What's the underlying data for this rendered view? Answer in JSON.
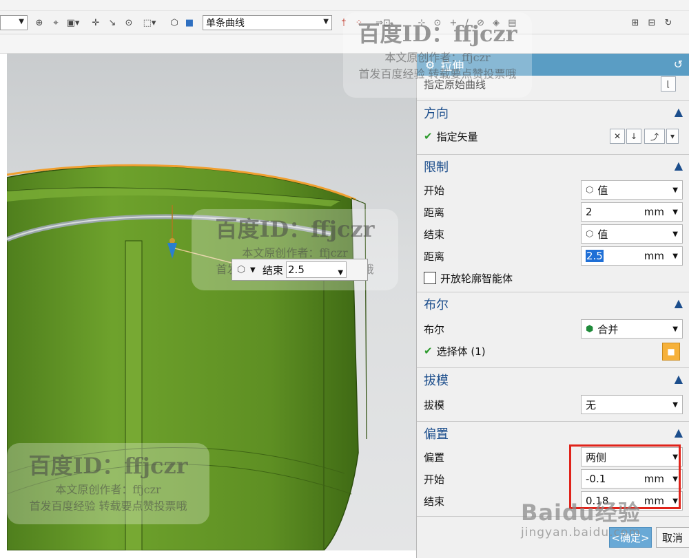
{
  "toolbar": {
    "curve_rule_value": "单条曲线",
    "icons": [
      "dropdown-icon",
      "snap-icon",
      "selection-icon",
      "box-select-icon",
      "render-icon",
      "cube-icon",
      "point-icon",
      "line-icon",
      "circle-icon",
      "fit-view-icon",
      "zoom-icon",
      "rotate-icon"
    ]
  },
  "viewport": {
    "float_label": "结束",
    "float_value": "2.5",
    "model_color": "#6e9f2e",
    "edge_highlight": "#f0a030"
  },
  "dialog": {
    "title": "拉伸",
    "specify_curve_label": "指定原始曲线",
    "direction": {
      "header": "方向",
      "vector_label": "指定矢量"
    },
    "limits": {
      "header": "限制",
      "start_label": "开始",
      "start_value": "值",
      "distance1_label": "距离",
      "distance1_value": "2",
      "distance1_unit": "mm",
      "end_label": "结束",
      "end_value": "值",
      "distance2_label": "距离",
      "distance2_value": "2.5",
      "distance2_unit": "mm",
      "open_profile_label": "开放轮廓智能体"
    },
    "boolean": {
      "header": "布尔",
      "label": "布尔",
      "value": "合并",
      "select_body_label": "选择体 (1)"
    },
    "draft": {
      "header": "拔模",
      "label": "拔模",
      "value": "无"
    },
    "offset": {
      "header": "偏置",
      "label": "偏置",
      "value": "两侧",
      "start_label": "开始",
      "start_value": "-0.1",
      "start_unit": "mm",
      "end_label": "结束",
      "end_value": "0.18",
      "end_unit": "mm"
    },
    "ok_label": "<确定>",
    "cancel_label": "取消"
  },
  "watermarks": {
    "id_text": "百度ID：ffjczr",
    "author_text": "本文原创作者：ffjczr",
    "note_text": "首发百度经验 转载要点赞投票哦",
    "baidu_logo": "Baidu经验",
    "baidu_url": "jingyan.baidu.com"
  }
}
